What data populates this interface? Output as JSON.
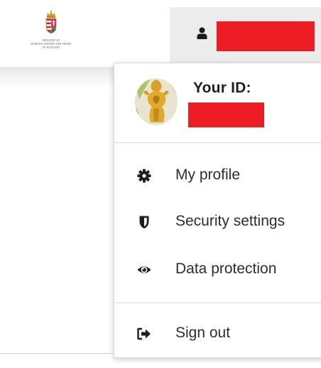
{
  "header": {
    "logo": {
      "text_lines": [
        "Ministry of",
        "Foreign Affairs and Trade",
        "of Hungary"
      ]
    },
    "user_menu_icon": "user-icon",
    "username": ""
  },
  "dropdown": {
    "id_label": "Your ID:",
    "id_value": "",
    "avatar_icon": "avatar-image",
    "items": [
      {
        "label": "My profile",
        "icon": "gear-icon"
      },
      {
        "label": "Security settings",
        "icon": "shield-icon"
      },
      {
        "label": "Data protection",
        "icon": "eye-icon"
      },
      {
        "label": "Sign out",
        "icon": "sign-out-icon"
      }
    ]
  },
  "colors": {
    "redaction": "#ee1c25",
    "header_bg": "#ececec",
    "icon": "#1e1e1e"
  }
}
